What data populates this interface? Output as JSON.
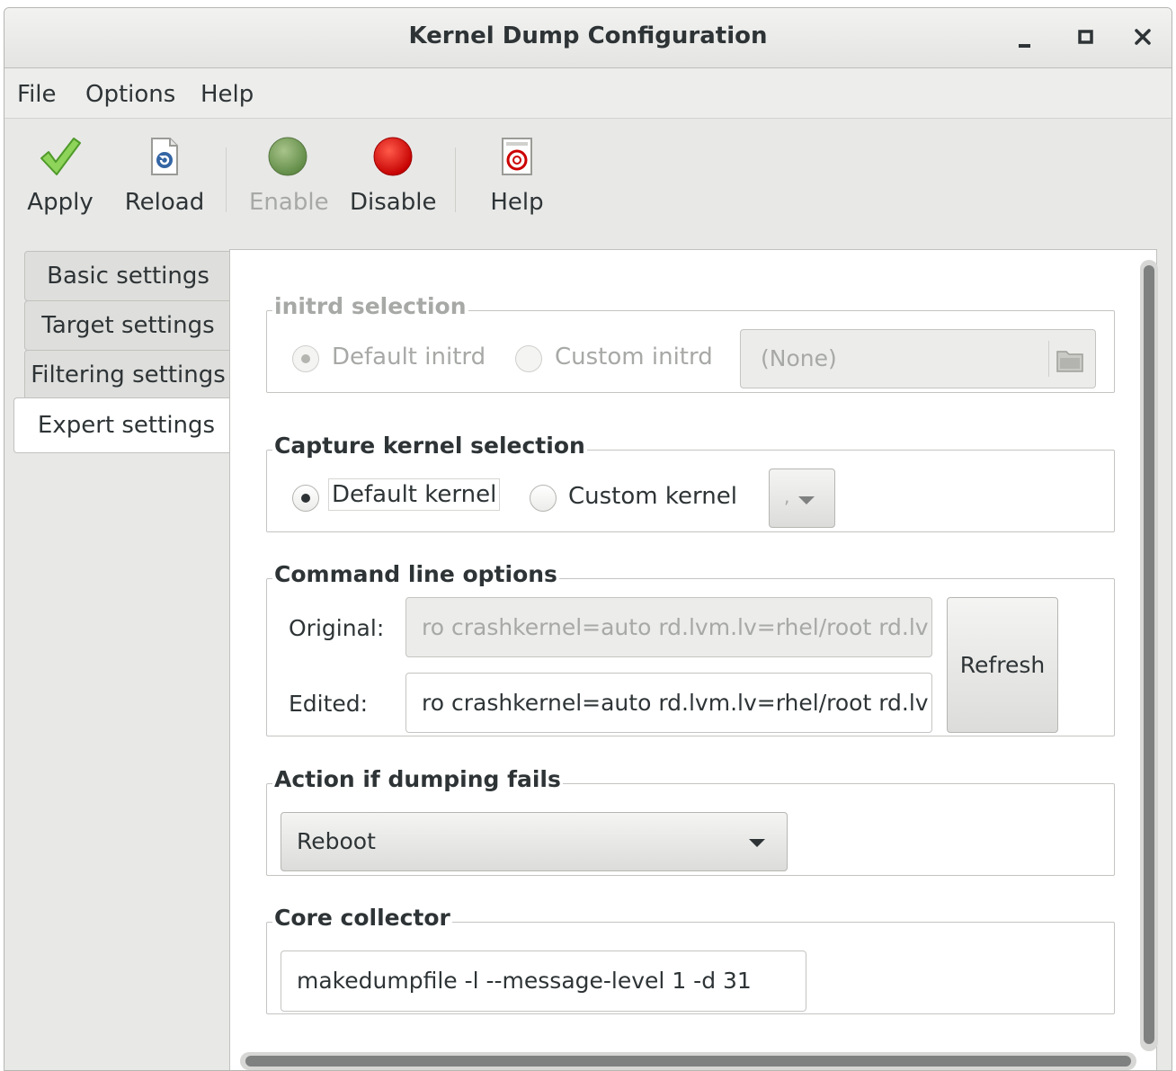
{
  "window": {
    "title": "Kernel Dump Configuration"
  },
  "menubar": {
    "items": [
      "File",
      "Options",
      "Help"
    ]
  },
  "toolbar": {
    "apply": "Apply",
    "reload": "Reload",
    "enable": "Enable",
    "disable": "Disable",
    "help": "Help"
  },
  "tabs": [
    "Basic settings",
    "Target settings",
    "Filtering settings",
    "Expert settings"
  ],
  "initrd": {
    "title": "initrd selection",
    "default_label": "Default initrd",
    "custom_label": "Custom initrd",
    "file_value": "(None)"
  },
  "capture_kernel": {
    "title": "Capture kernel selection",
    "default_label": "Default kernel",
    "custom_label": "Custom kernel",
    "combo_value": ","
  },
  "cmdline": {
    "title": "Command line options",
    "original_label": "Original:",
    "original_value": "ro crashkernel=auto rd.lvm.lv=rhel/root rd.lv",
    "edited_label": "Edited:",
    "edited_value": "ro crashkernel=auto rd.lvm.lv=rhel/root rd.lv",
    "refresh_label": "Refresh"
  },
  "action": {
    "title": "Action if dumping fails",
    "selected": "Reboot"
  },
  "core_collector": {
    "title": "Core collector",
    "value": "makedumpfile -l --message-level 1 -d 31"
  }
}
